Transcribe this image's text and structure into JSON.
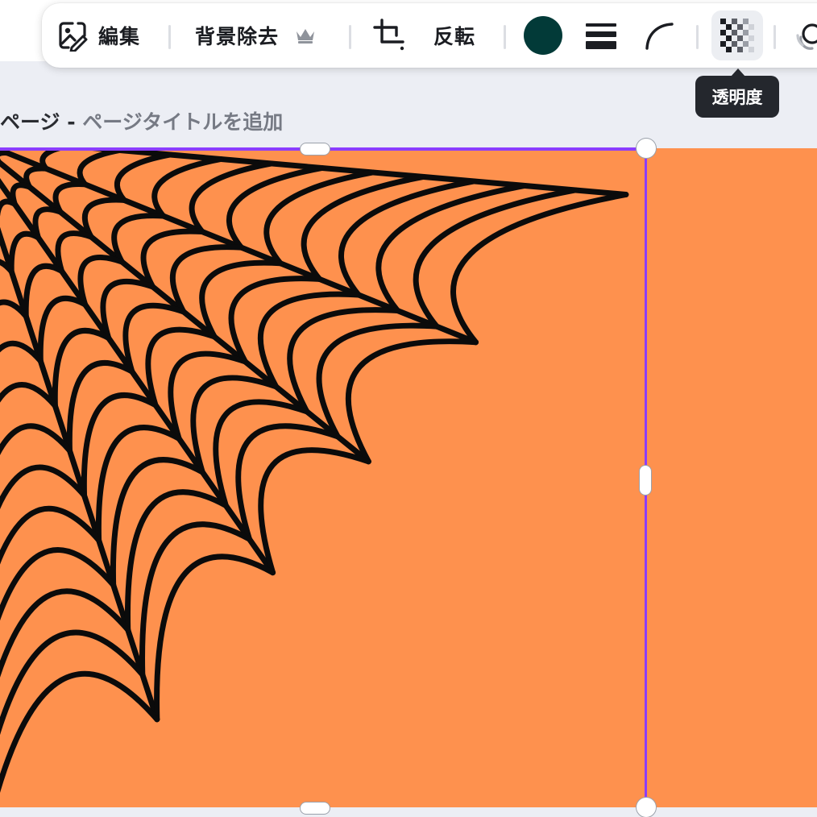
{
  "toolbar": {
    "edit_label": "編集",
    "bg_remove_label": "背景除去",
    "flip_label": "反転",
    "color_swatch": "#023a38",
    "icons": {
      "edit": "image-edit-icon",
      "premium": "crown-icon",
      "crop": "crop-icon",
      "border_style": "line-weight-icon",
      "corner": "corner-rounding-icon",
      "transparency": "transparency-icon",
      "animate": "animate-icon"
    }
  },
  "tooltip": {
    "text": "透明度"
  },
  "page": {
    "title_prefix": "ページ - ",
    "title_placeholder": "ページタイトルを追加"
  },
  "canvas": {
    "background": "#fe914e",
    "selection_color": "#8b3dff",
    "element_icon": "spider-web-icon"
  }
}
